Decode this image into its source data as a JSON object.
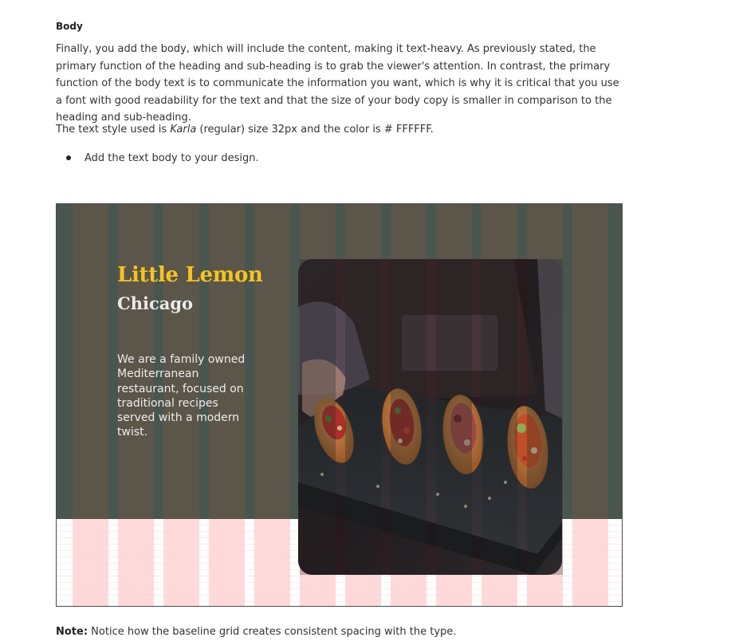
{
  "section": {
    "heading": "Body",
    "paragraph": "Finally, you add the body, which will include the content, making it text-heavy. As previously stated, the primary function of the heading and sub-heading is to grab the viewer's attention. In contrast, the primary function of the body text is to communicate the information you want, which is why it is critical that you use a font with good readability for the text and that the size of your body copy is smaller in comparison to the heading and sub-heading.",
    "style_prefix": "The text style used is ",
    "style_font": "Karla",
    "style_suffix": " (regular) size 32px and the color is # FFFFFF.",
    "bullets": [
      "Add the text body to your design."
    ]
  },
  "figure": {
    "title": "Little Lemon",
    "subtitle": "Chicago",
    "body": "We are a family owned Mediterranean restaurant, focused on traditional recipes served with a modern twist.",
    "colors": {
      "background": "#48564f",
      "column_overlay": "#6e5546",
      "baseline_area": "#ffcdcd",
      "title": "#f4c324",
      "text": "#ffffff"
    }
  },
  "note": {
    "label": "Note:",
    "text": " Notice how the baseline grid creates consistent spacing with the type."
  }
}
